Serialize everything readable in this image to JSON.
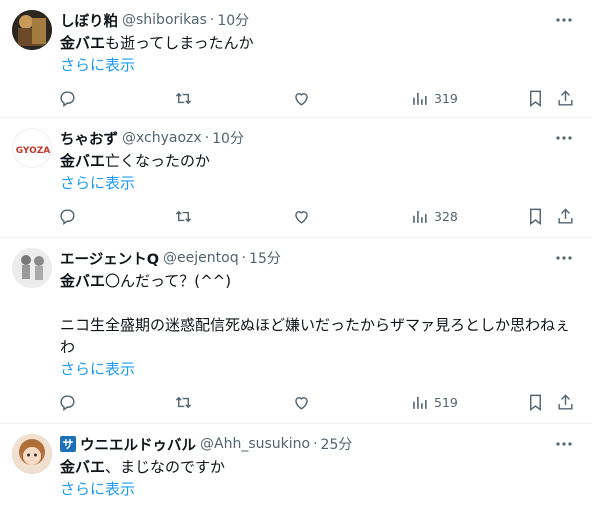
{
  "tweets": [
    {
      "name": "しぼり粕",
      "handle": "@shiborikas",
      "time": "10分",
      "body_bold": "金バエ",
      "body_rest": "も逝ってしまったんか",
      "show_more": "さらに表示",
      "views": "319",
      "avatar_color": "#3b3b3b"
    },
    {
      "name": "ちゃおず",
      "handle": "@xchyaozx",
      "time": "10分",
      "body_bold": "金バエ",
      "body_rest": "亡くなったのか",
      "show_more": "さらに表示",
      "views": "328",
      "avatar_text": "GYOZA",
      "avatar_color": "#ffffff"
    },
    {
      "name": "エージェントQ",
      "handle": "@eejentoq",
      "time": "15分",
      "body_bold": "金バエ",
      "body_rest": "〇んだって？(^^)\n\nニコ生全盛期の迷惑配信死ぬほど嫌いだったからザマァ見ろとしか思わねぇわ",
      "show_more": "さらに表示",
      "views": "519",
      "avatar_color": "#d9d9d9"
    },
    {
      "badge": "サ",
      "name": "ウニエルドゥバル",
      "handle": "@Ahh_susukino",
      "time": "25分",
      "body_bold": "金バエ",
      "body_rest": "、まじなのですか",
      "show_more": "さらに表示",
      "avatar_color": "#c9966b"
    }
  ],
  "separator": "·",
  "icons": [
    "reply-icon",
    "retweet-icon",
    "like-icon",
    "views-icon",
    "bookmark-icon",
    "share-icon",
    "more-icon"
  ]
}
